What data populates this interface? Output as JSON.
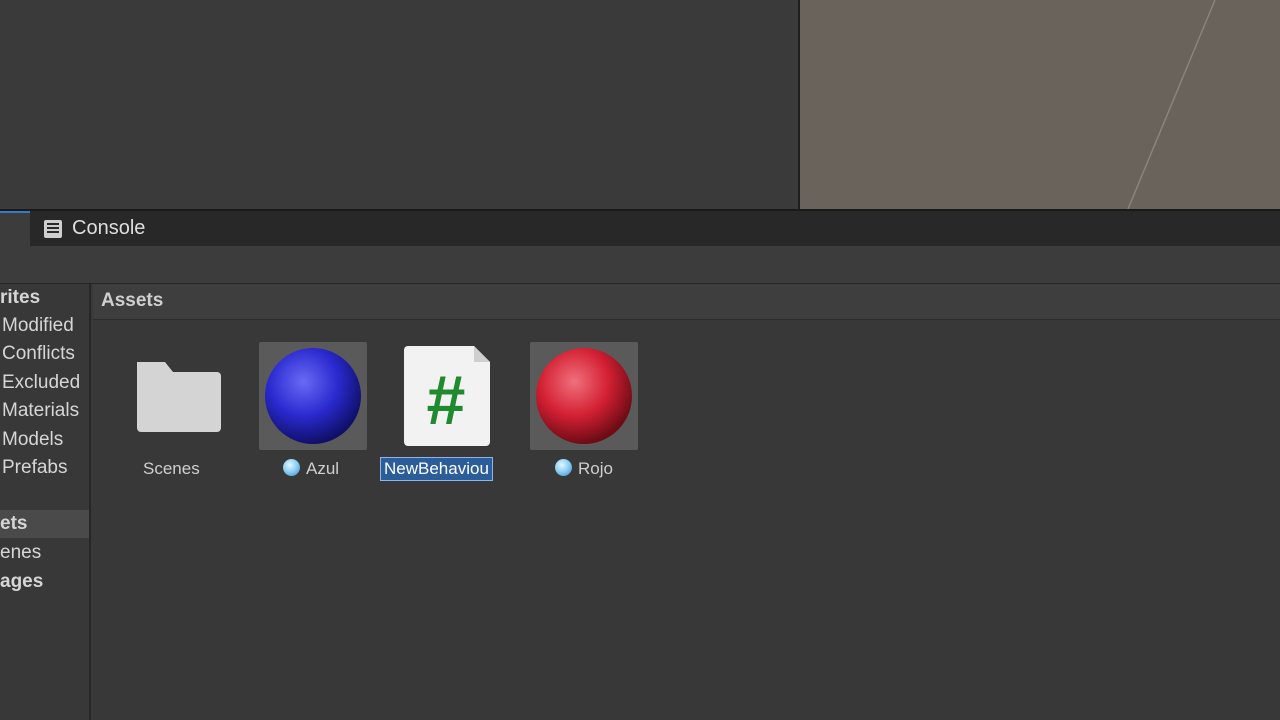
{
  "tabs": {
    "console_label": "Console"
  },
  "tree": {
    "favorites_heading": "rites",
    "favorites": [
      "Modified",
      "Conflicts",
      "Excluded",
      "Materials",
      "Models",
      "Prefabs"
    ],
    "assets_label": "ets",
    "scenes_label": "enes",
    "packages_label": "ages"
  },
  "breadcrumb": {
    "current": "Assets"
  },
  "assets": {
    "scenes": {
      "label": "Scenes",
      "icon": "folder-icon"
    },
    "azul": {
      "label": "Azul",
      "icon": "material-sphere-icon",
      "color": "#2b2bd6"
    },
    "script": {
      "label": "NewBehaviou",
      "icon": "csharp-script-icon",
      "glyph": "#",
      "color": "#1f8a2e"
    },
    "rojo": {
      "label": "Rojo",
      "icon": "material-sphere-icon",
      "color": "#d32033"
    }
  },
  "colors": {
    "selection": "#2c5d9b",
    "scene_background": "#69635c"
  }
}
